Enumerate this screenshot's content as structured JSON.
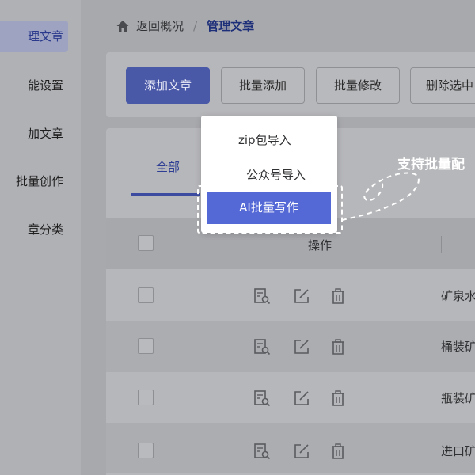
{
  "sidebar": {
    "items": [
      {
        "label": "理文章",
        "active": true
      },
      {
        "label": "能设置",
        "active": false
      },
      {
        "label": "加文章",
        "active": false
      },
      {
        "label": "批量创作",
        "active": false
      },
      {
        "label": "章分类",
        "active": false
      }
    ]
  },
  "breadcrumb": {
    "back": "返回概况",
    "separator": "/",
    "current": "管理文章"
  },
  "toolbar": {
    "add_article": "添加文章",
    "batch_add": "批量添加",
    "batch_edit": "批量修改",
    "delete_selected": "删除选中"
  },
  "dropdown": {
    "items": [
      "zip包导入",
      "公众号导入",
      "AI批量写作"
    ]
  },
  "callout": "支持批量配",
  "tabs": {
    "all": "全部"
  },
  "table": {
    "header_ops": "操作",
    "rows": [
      {
        "text": "矿泉水"
      },
      {
        "text": "桶装矿"
      },
      {
        "text": "瓶装矿"
      },
      {
        "text": "进口矿"
      }
    ]
  },
  "icons": [
    "home-icon",
    "preview-icon",
    "edit-icon",
    "delete-icon"
  ],
  "colors": {
    "primary": "#4a58a8",
    "highlight": "#5468d6",
    "accent_text": "#1e2f7a"
  }
}
